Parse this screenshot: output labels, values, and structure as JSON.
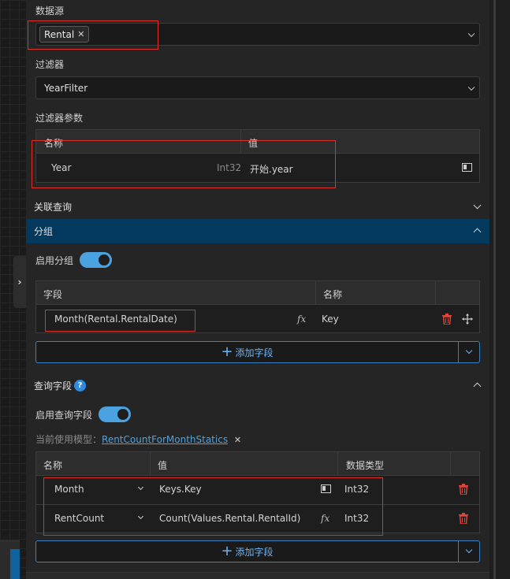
{
  "datasource": {
    "label": "数据源",
    "tag": "Rental",
    "tag_remove": "✕"
  },
  "filter": {
    "label": "过滤器",
    "value": "YearFilter"
  },
  "filter_params": {
    "label": "过滤器参数",
    "headers": {
      "name": "名称",
      "value": "值"
    },
    "row": {
      "name": "Year",
      "type": "Int32",
      "value": "开始.year"
    }
  },
  "sections": {
    "join": "关联查询",
    "group": "分组",
    "query_fields": "查询字段"
  },
  "group": {
    "enable_label": "启用分组",
    "enabled": true,
    "headers": {
      "field": "字段",
      "name": "名称"
    },
    "row": {
      "field": "Month(Rental.RentalDate)",
      "name": "Key"
    },
    "add_label": "添加字段"
  },
  "query": {
    "help": "?",
    "enable_label": "启用查询字段",
    "enabled": true,
    "model_prefix": "当前使用模型：",
    "model_name": "RentCountForMonthStatics",
    "model_remove": "✕",
    "headers": {
      "name": "名称",
      "value": "值",
      "type": "数据类型"
    },
    "rows": [
      {
        "name": "Month",
        "value": "Keys.Key",
        "type": "Int32"
      },
      {
        "name": "RentCount",
        "value": "Count(Values.Rental.RentalId)",
        "type": "Int32"
      }
    ],
    "add_label": "添加字段"
  },
  "icons": {
    "fx": "fx",
    "expand": "›"
  },
  "colors": {
    "accent": "#4aa3e0",
    "highlight": "#e0302a",
    "section_active": "#04395e",
    "delete": "#e0453a"
  }
}
